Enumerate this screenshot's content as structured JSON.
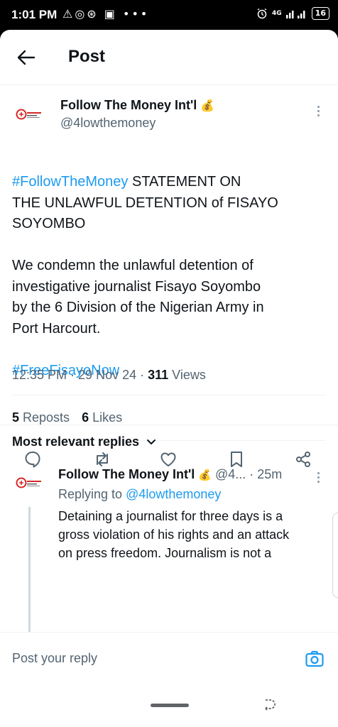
{
  "status_bar": {
    "time": "1:01 PM",
    "left_icons": "⚠◎⊛ ▣ •••",
    "signal": "4G",
    "battery": "16"
  },
  "header": {
    "title": "Post"
  },
  "post": {
    "author_name": "Follow The Money Int'l",
    "author_emoji": "💰",
    "author_handle": "@4lowthemoney",
    "text_hashtag_1": "#FollowTheMoney",
    "text_line_1_rest": " STATEMENT ON",
    "text_line_2": "THE UNLAWFUL DETENTION of FISAYO",
    "text_line_3": "SOYOMBO",
    "text_para_2_line_1": "We condemn the unlawful detention of",
    "text_para_2_line_2": "investigative journalist Fisayo Soyombo",
    "text_para_2_line_3": "by the 6 Division of the Nigerian Army in",
    "text_para_2_line_4": "Port Harcourt.",
    "text_hashtag_2": "#FreeFisayoNow",
    "timestamp": "12:35 PM · 29 Nov 24 · ",
    "views_count": "311",
    "views_label": " Views",
    "reposts_count": "5",
    "reposts_label": " Reposts",
    "likes_count": "6",
    "likes_label": " Likes"
  },
  "replies_section": {
    "title": "Most relevant replies"
  },
  "reply": {
    "author_name": "Follow The Money Int'l",
    "author_emoji": "💰",
    "handle_time": " @4... · 25m",
    "replying_to_label": "Replying to ",
    "replying_to_handle": "@4lowthemoney",
    "text_line_1": "Detaining a journalist for three days is a",
    "text_line_2": "gross violation of his rights and an attack",
    "text_line_3": "on press freedom. Journalism is not a"
  },
  "reply_bar": {
    "placeholder": "Post your reply"
  },
  "colors": {
    "accent": "#1d9bf0",
    "text": "#0f1419",
    "muted": "#536471"
  }
}
